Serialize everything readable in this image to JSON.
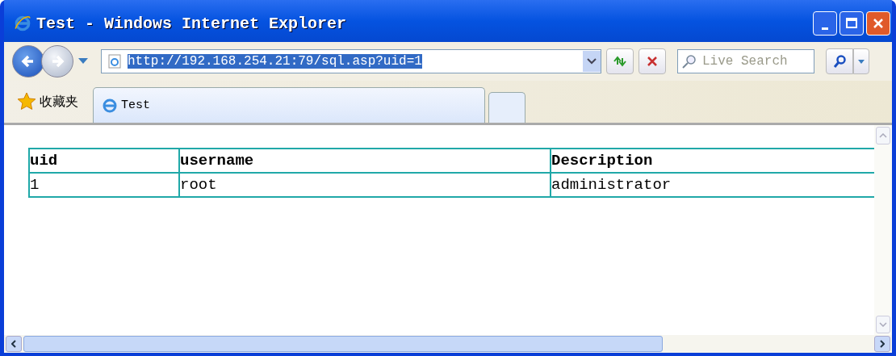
{
  "window": {
    "title": "Test - Windows Internet Explorer"
  },
  "address_bar": {
    "value": "http://192.168.254.21:79/sql.asp?uid=1"
  },
  "search": {
    "placeholder": "Live Search"
  },
  "favorites": {
    "label": "收藏夹"
  },
  "tabs": [
    {
      "label": "Test",
      "selected": true
    }
  ],
  "table": {
    "columns": [
      "uid",
      "username",
      "Description"
    ],
    "rows": [
      [
        "1",
        "root",
        "administrator"
      ]
    ]
  }
}
